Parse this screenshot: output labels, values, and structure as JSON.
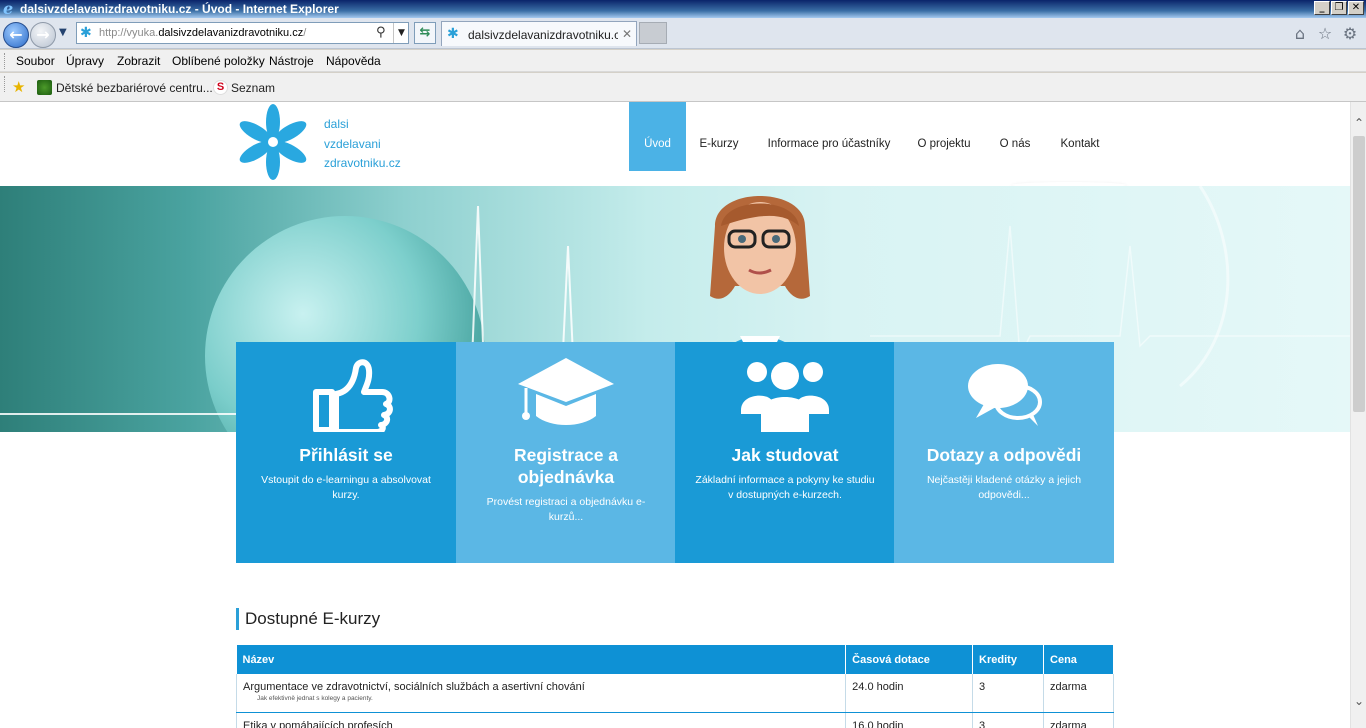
{
  "window": {
    "title": "dalsivzdelavanizdravotniku.cz - Úvod - Internet Explorer",
    "minimize": "_",
    "restore": "❐",
    "close": "✕"
  },
  "browser": {
    "back": "←",
    "forward": "→",
    "url_prefix": "http://vyuka.",
    "url_domain": "dalsivzdelavanizdravotniku.cz",
    "url_suffix": "/",
    "tab_title": "dalsivzdelavanizdravotniku.c...",
    "tab_close": "✕"
  },
  "menubar": [
    "Soubor",
    "Úpravy",
    "Zobrazit",
    "Oblíbené položky",
    "Nástroje",
    "Nápověda"
  ],
  "favorites": {
    "item1": "Dětské bezbariérové centru...",
    "item2_logo": "S",
    "item2": "Seznam"
  },
  "site": {
    "logo_lines": [
      "dalsi",
      "vzdelavani",
      "zdravotniku.cz"
    ],
    "nav": [
      "Úvod",
      "E-kurzy",
      "Informace pro účastníky",
      "O projektu",
      "O nás",
      "Kontakt"
    ],
    "nav_active": 0,
    "colors": {
      "accent": "#2aa0d8",
      "box_dark": "#1a9ad6",
      "box_light": "#5bb7e5",
      "table_head": "#0e91d5"
    }
  },
  "features": [
    {
      "icon": "thumb-up-icon",
      "title": "Přihlásit se",
      "desc": "Vstoupit do e-learningu a absolvovat kurzy."
    },
    {
      "icon": "graduation-cap-icon",
      "title": "Registrace a objednávka",
      "desc": "Provést registraci a objednávku e-kurzů..."
    },
    {
      "icon": "users-group-icon",
      "title": "Jak studovat",
      "desc": "Základní informace a pokyny ke studiu v dostupných e-kurzech."
    },
    {
      "icon": "chat-bubbles-icon",
      "title": "Dotazy a odpovědi",
      "desc": "Nejčastěji kladené otázky a jejich odpovědi..."
    }
  ],
  "courses": {
    "heading": "Dostupné E-kurzy",
    "columns": [
      "Název",
      "Časová dotace",
      "Kredity",
      "Cena"
    ],
    "rows": [
      {
        "name": "Argumentace ve zdravotnictví, sociálních službách a asertivní chování",
        "sub": "Jak efektivně jednat s kolegy a pacienty.",
        "hours": "24.0 hodin",
        "credits": "3",
        "price": "zdarma"
      },
      {
        "name": "Etika v pomáhajících profesích",
        "sub": "",
        "hours": "16.0 hodin",
        "credits": "3",
        "price": "zdarma"
      }
    ]
  }
}
